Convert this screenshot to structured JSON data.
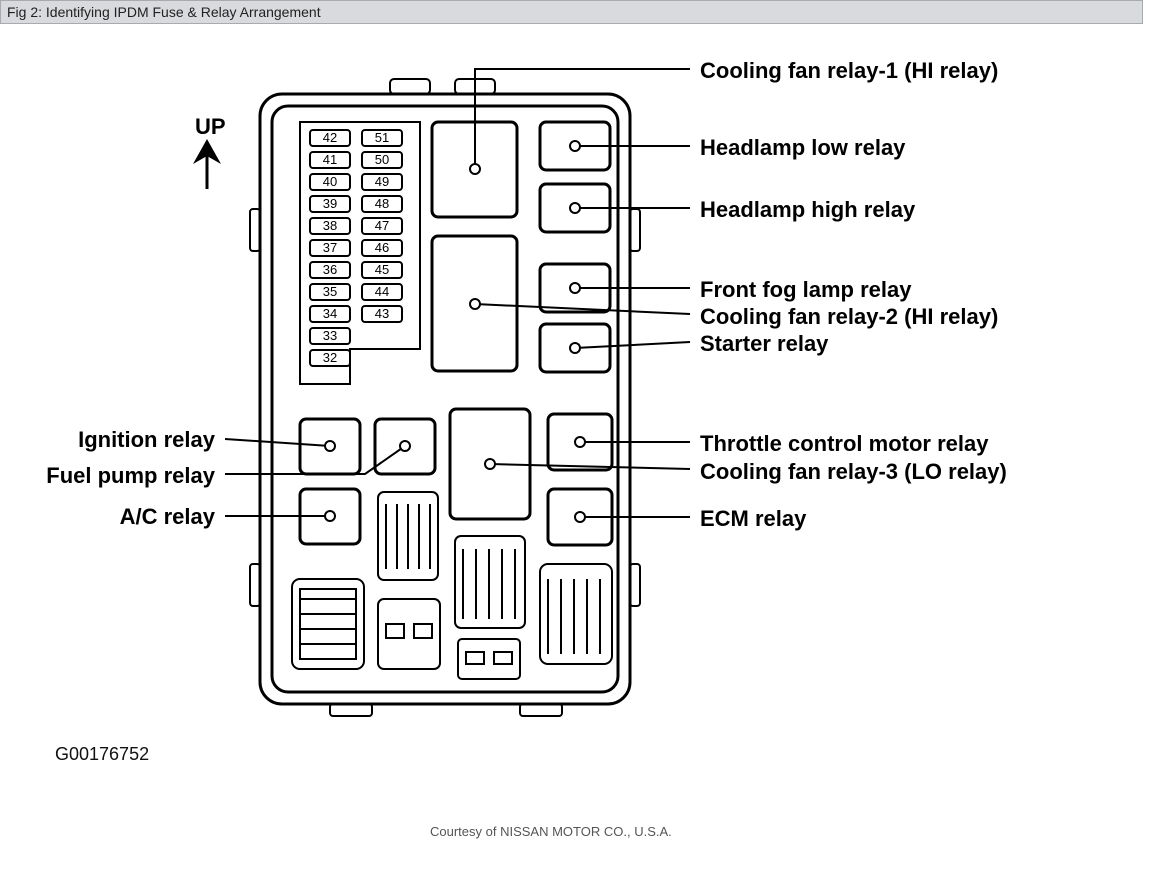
{
  "title": "Fig 2: Identifying IPDM Fuse & Relay Arrangement",
  "credit": "Courtesy of NISSAN MOTOR CO., U.S.A.",
  "figure_id": "G00176752",
  "up_label": "UP",
  "fuses_left": [
    "42",
    "41",
    "40",
    "39",
    "38",
    "37",
    "36",
    "35",
    "34",
    "33",
    "32"
  ],
  "fuses_right": [
    "51",
    "50",
    "49",
    "48",
    "47",
    "46",
    "45",
    "44",
    "43"
  ],
  "labels": {
    "cool1": "Cooling fan relay-1 (HI relay)",
    "hl_low": "Headlamp low relay",
    "hl_high": "Headlamp high relay",
    "fog": "Front fog lamp relay",
    "cool2": "Cooling fan relay-2 (HI relay)",
    "starter": "Starter relay",
    "throttle": "Throttle control motor relay",
    "cool3": "Cooling fan relay-3 (LO relay)",
    "ecm": "ECM relay",
    "ign": "Ignition relay",
    "fuel": "Fuel pump relay",
    "ac": "A/C relay"
  }
}
